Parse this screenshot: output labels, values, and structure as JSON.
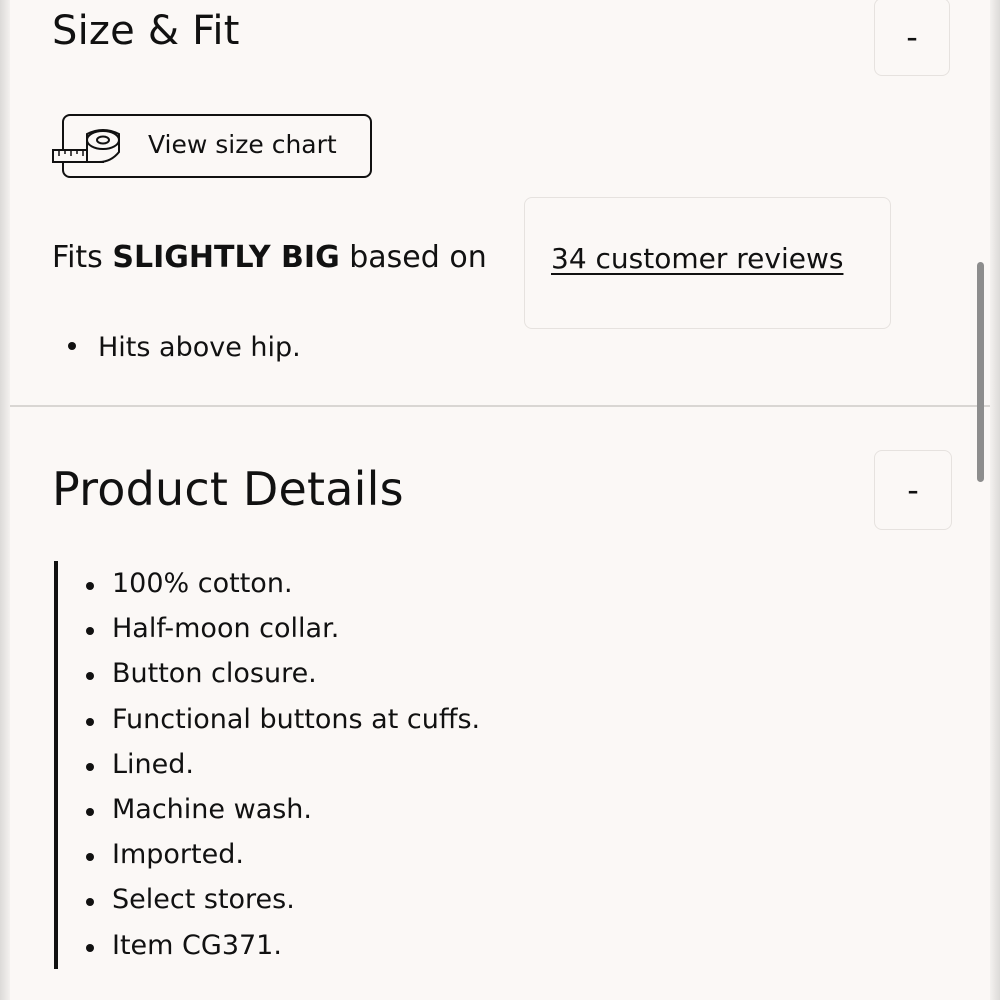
{
  "size_fit": {
    "title": "Size & Fit",
    "toggle_label": "-",
    "size_chart_label": "View size chart",
    "size_chart_icon": "measuring-tape-icon",
    "fit_prefix": "Fits",
    "fit_value": "SLIGHTLY BIG",
    "fit_suffix": "based on",
    "reviews_link": "34 customer reviews",
    "bullets": [
      "Hits above hip."
    ]
  },
  "product_details": {
    "title": "Product Details",
    "toggle_label": "-",
    "items": [
      "100% cotton.",
      "Half-moon collar.",
      "Button closure.",
      "Functional buttons at cuffs.",
      "Lined.",
      "Machine wash.",
      "Imported.",
      "Select stores.",
      "Item CG371."
    ]
  },
  "colors": {
    "background": "#fbf8f6",
    "text": "#111111",
    "border": "#e6e2df",
    "divider": "#d9d6d3",
    "scrollbar": "#8d8d8d"
  }
}
